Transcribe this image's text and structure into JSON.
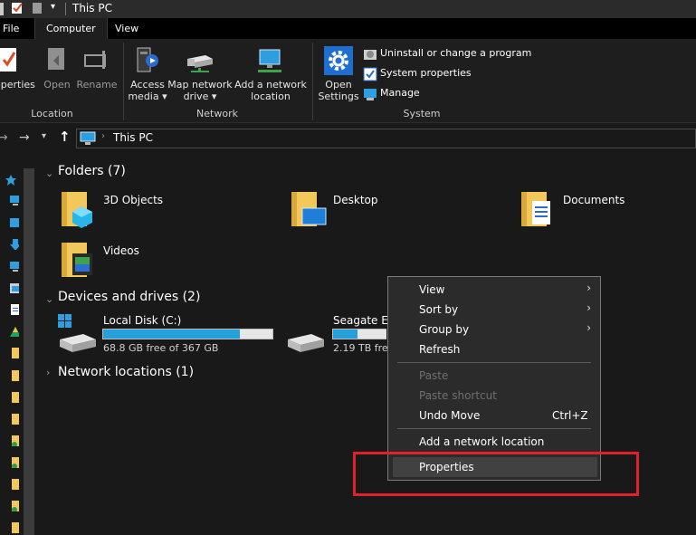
{
  "window": {
    "title": "This PC"
  },
  "tabs": [
    {
      "label": "File"
    },
    {
      "label": "Computer"
    },
    {
      "label": "View"
    }
  ],
  "ribbon": {
    "location": {
      "properties": "operties",
      "open": "Open",
      "rename": "Rename",
      "group": "Location"
    },
    "network": {
      "access_media": "Access\nmedia ▾",
      "access_media_l1": "Access",
      "access_media_l2": "media",
      "map_drive_l1": "Map network",
      "map_drive_l2": "drive",
      "add_location_l1": "Add a network",
      "add_location_l2": "location",
      "group": "Network"
    },
    "system": {
      "open_settings_l1": "Open",
      "open_settings_l2": "Settings",
      "uninstall": "Uninstall or change a program",
      "system_properties": "System properties",
      "manage": "Manage",
      "group": "System"
    }
  },
  "address": {
    "path": "This PC"
  },
  "content": {
    "folders_header": "Folders (7)",
    "folders": [
      {
        "name": "3D Objects"
      },
      {
        "name": "Desktop"
      },
      {
        "name": "Documents"
      },
      {
        "name": "Videos"
      }
    ],
    "devices_header": "Devices and drives (2)",
    "drives": [
      {
        "name": "Local Disk (C:)",
        "free": "68.8 GB free of 367 GB",
        "used_fraction": 0.81
      },
      {
        "name": "Seagate Exp",
        "free": "2.19 TB free",
        "used_fraction": 0.45
      }
    ],
    "network_header": "Network locations (1)"
  },
  "context_menu": {
    "view": "View",
    "sort_by": "Sort by",
    "group_by": "Group by",
    "refresh": "Refresh",
    "paste": "Paste",
    "paste_shortcut": "Paste shortcut",
    "undo_move": "Undo Move",
    "undo_shortcut": "Ctrl+Z",
    "add_network_location": "Add a network location",
    "properties": "Properties"
  },
  "colors": {
    "accent": "#26a0da",
    "highlight": "#e0202a",
    "folder": "#f3c85a"
  }
}
